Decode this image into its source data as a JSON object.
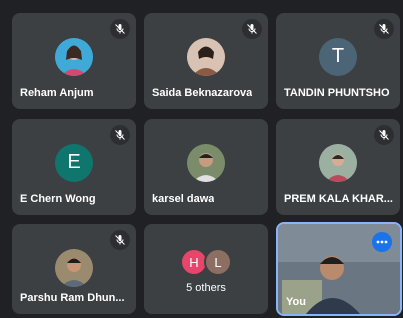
{
  "participants": [
    {
      "name": "Reham Anjum",
      "avatar": "photo",
      "avatar_bg": "#3fa9d8"
    },
    {
      "name": "Saida Beknazarova",
      "avatar": "photo",
      "avatar_bg": "#caa58f"
    },
    {
      "name": "TANDIN PHUNTSHO",
      "avatar": "letter",
      "letter": "T",
      "avatar_bg": "#4b6576"
    },
    {
      "name": "E Chern Wong",
      "avatar": "letter",
      "letter": "E",
      "avatar_bg": "#0f766e"
    },
    {
      "name": "karsel dawa",
      "avatar": "photo",
      "avatar_bg": "#6d7a5e"
    },
    {
      "name": "PREM KALA KHAR...",
      "avatar": "photo",
      "avatar_bg": "#7f9aa5"
    },
    {
      "name": "Parshu Ram Dhun...",
      "avatar": "photo",
      "avatar_bg": "#8c7a62"
    }
  ],
  "others": {
    "label": "5 others",
    "badges": [
      {
        "letter": "H",
        "color": "#e8456b"
      },
      {
        "letter": "L",
        "color": "#8d6e63"
      }
    ]
  },
  "self_tile": {
    "label": "You"
  },
  "icons": {
    "mute": "mic-off-icon",
    "more": "more-options-icon"
  }
}
